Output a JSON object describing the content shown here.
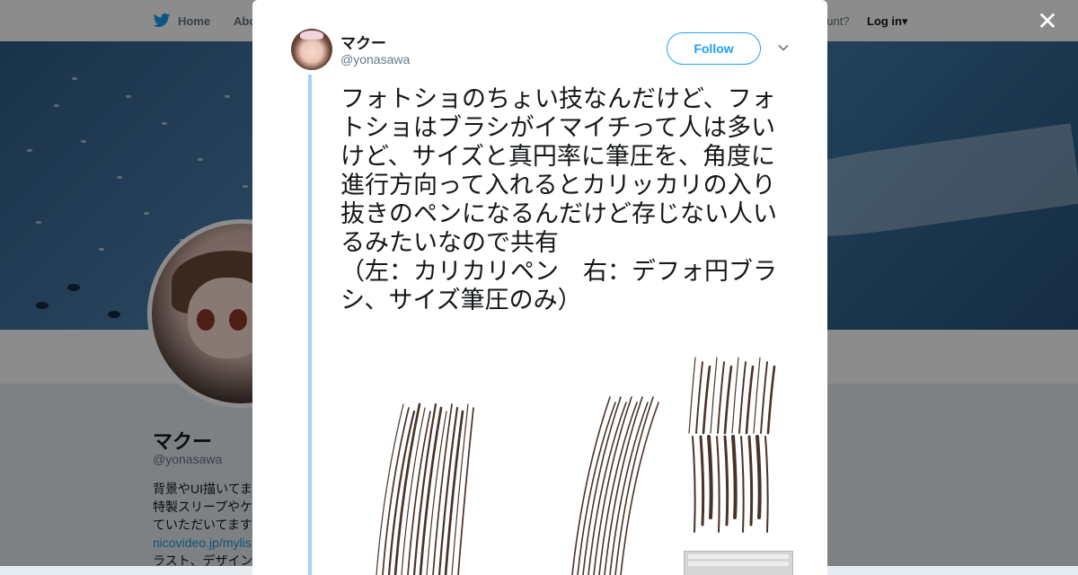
{
  "background_page": {
    "nav": {
      "home_label": "Home",
      "about_label": "Abo",
      "account_prompt": "ccount?",
      "login_label": "Log in"
    },
    "profile": {
      "name": "マクー",
      "handle": "@yonasawa",
      "bio_lines": [
        "背景やUI描いてま",
        "特製スリープやケ",
        "ていただいてます",
        "nicovideo.jp/mylis",
        "ラスト、デザイン"
      ]
    }
  },
  "modal": {
    "author": {
      "name": "マクー",
      "handle": "@yonasawa"
    },
    "follow_label": "Follow",
    "tweet_text": "フォトショのちょい技なんだけど、フォトショはブラシがイマイチって人は多いけど、サイズと真円率に筆圧を、角度に進行方向って入れるとカリッカリの入り抜きのペンになるんだけど存じない人いるみたいなので共有\n（左：カリカリペン　右：デフォ円ブラシ、サイズ筆圧のみ）"
  },
  "colors": {
    "accent": "#1da1f2",
    "thread_line": "#a6d4f2",
    "stroke": "#4a3328"
  },
  "icons": [
    "twitter-bird-icon",
    "caret-down-icon",
    "close-icon",
    "chevron-down-icon"
  ]
}
